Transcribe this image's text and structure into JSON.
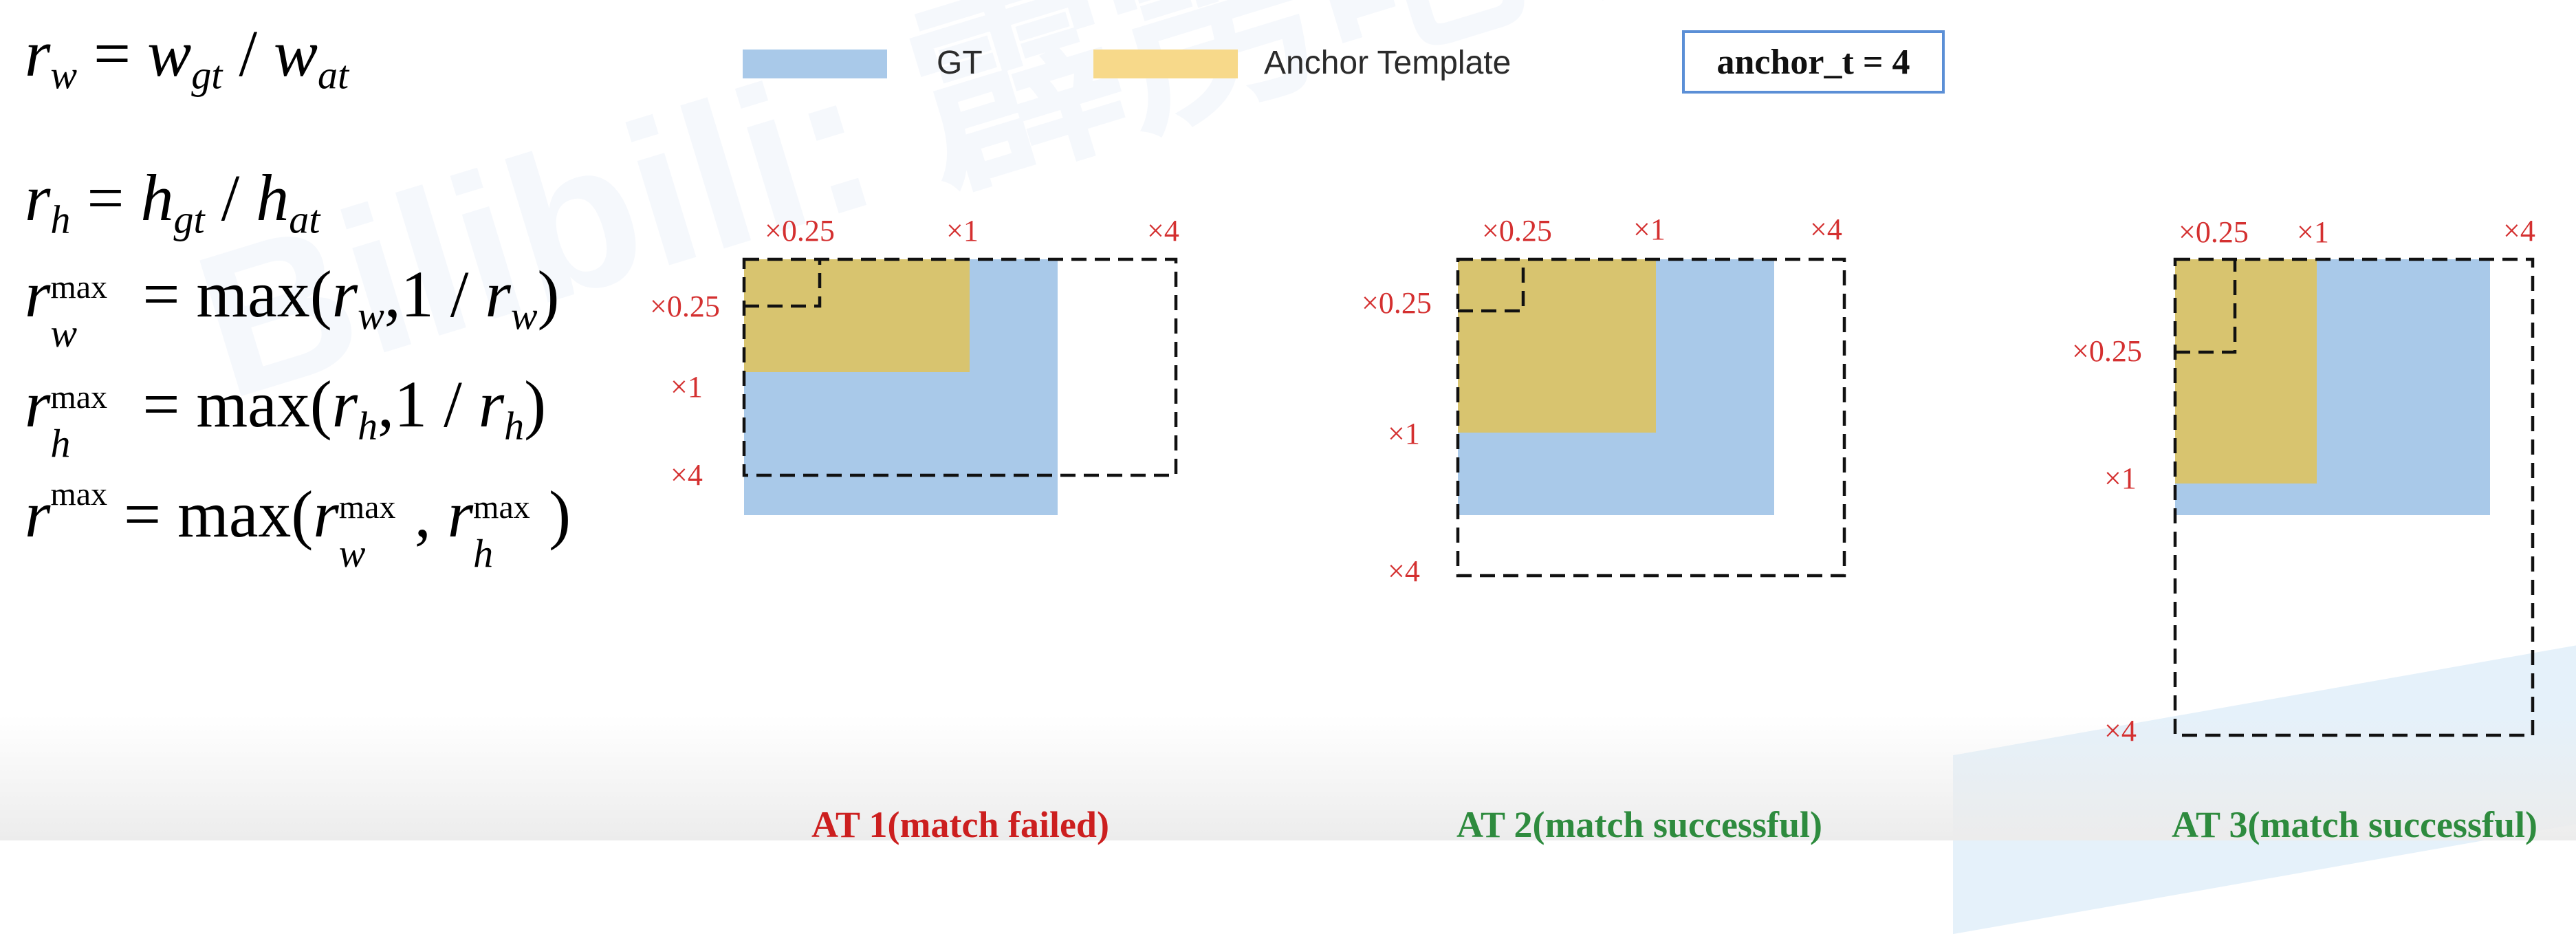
{
  "formulas": {
    "rw": {
      "lhs": "r",
      "lhs_sub": "w",
      "a": "w",
      "a_sub": "gt",
      "b": "w",
      "b_sub": "at"
    },
    "rh": {
      "lhs": "r",
      "lhs_sub": "h",
      "a": "h",
      "a_sub": "gt",
      "b": "h",
      "b_sub": "at"
    },
    "rw_max": {
      "lhs": "r",
      "lhs_sub": "w",
      "sup": "max",
      "func": "max",
      "arg": "r",
      "arg_sub": "w",
      "num": "1",
      "den": "r",
      "den_sub": "w"
    },
    "rh_max": {
      "lhs": "r",
      "lhs_sub": "h",
      "sup": "max",
      "func": "max",
      "arg": "r",
      "arg_sub": "h",
      "num": "1",
      "den": "r",
      "den_sub": "h"
    },
    "r_max": {
      "lhs": "r",
      "sup": "max",
      "func": "max",
      "arg1": "r",
      "arg1_sub": "w",
      "arg1_sup": "max",
      "arg2": "r",
      "arg2_sub": "h",
      "arg2_sup": "max"
    }
  },
  "legend": {
    "gt": {
      "label": "GT",
      "color": "#a9c9e9"
    },
    "anchor": {
      "label": "Anchor Template",
      "color": "#f7d98a"
    },
    "param": "anchor_t = 4"
  },
  "colors": {
    "gt_fill": "#a9c9e9",
    "anchor_fill": "#d8c46f",
    "scale_label": "#d43030",
    "fail": "#cc1f1f",
    "success": "#2e8b3e"
  },
  "panels": [
    {
      "id": "at1",
      "caption": "AT 1(match failed)",
      "status": "fail",
      "top_labels": [
        "×0.25",
        "×1",
        "×4"
      ],
      "side_labels": [
        "×0.25",
        "×1",
        "×4"
      ]
    },
    {
      "id": "at2",
      "caption": "AT 2(match successful)",
      "status": "success",
      "top_labels": [
        "×0.25",
        "×1",
        "×4"
      ],
      "side_labels": [
        "×0.25",
        "×1",
        "×4"
      ]
    },
    {
      "id": "at3",
      "caption": "AT 3(match successful)",
      "status": "success",
      "top_labels": [
        "×0.25",
        "×1",
        "×4"
      ],
      "side_labels": [
        "×0.25",
        "×1",
        "×4"
      ]
    }
  ],
  "watermark": "Bilibili: 霹雳吧啦Wz"
}
